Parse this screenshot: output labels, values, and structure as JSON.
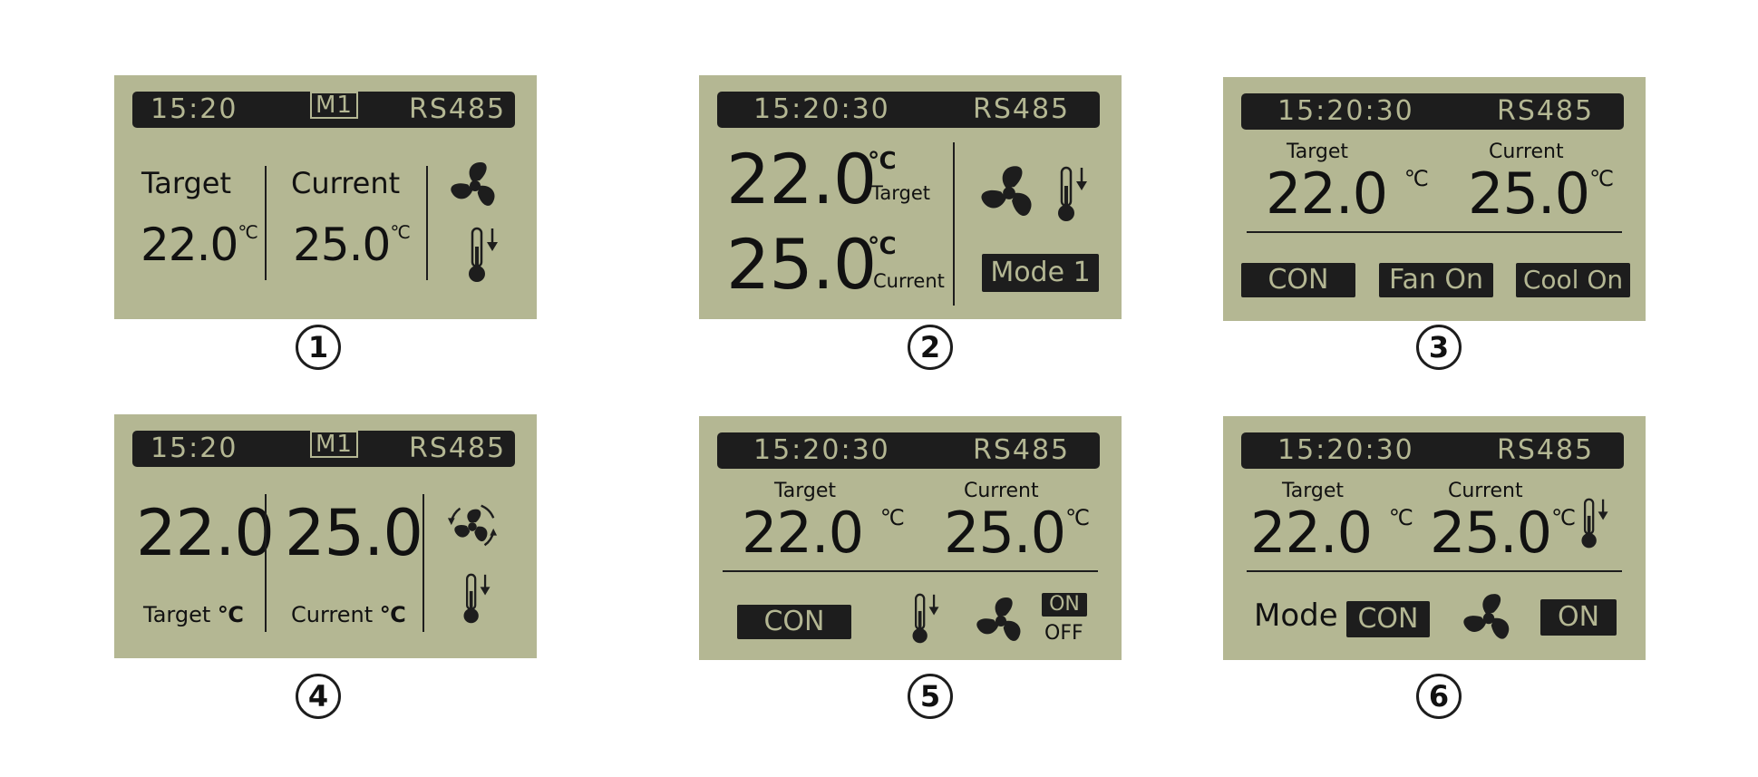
{
  "colors": {
    "lcd": "#b4b793",
    "ink": "#1d1d1d",
    "background": "#ffffff"
  },
  "icons": [
    "fan-icon",
    "fan-rotate-icon",
    "thermometer-down-icon"
  ],
  "screens": [
    {
      "index": "1",
      "clock": "15:20",
      "mode_badge": "M1",
      "comm": "RS485",
      "target_label": "Target",
      "target_value": "22.0",
      "current_label": "Current",
      "current_value": "25.0",
      "unit": "℃"
    },
    {
      "index": "2",
      "clock": "15:20:30",
      "comm": "RS485",
      "target_value": "22.0",
      "target_label": "Target",
      "current_value": "25.0",
      "current_label": "Current",
      "unit": "℃",
      "mode_label": "Mode 1"
    },
    {
      "index": "3",
      "clock": "15:20:30",
      "comm": "RS485",
      "target_label": "Target",
      "target_value": "22.0",
      "current_label": "Current",
      "current_value": "25.0",
      "unit": "℃",
      "chips": [
        "CON",
        "Fan On",
        "Cool On"
      ]
    },
    {
      "index": "4",
      "clock": "15:20",
      "mode_badge": "M1",
      "comm": "RS485",
      "target_value": "22.0",
      "current_value": "25.0",
      "target_label": "Target",
      "current_label": "Current",
      "unit": "℃"
    },
    {
      "index": "5",
      "clock": "15:20:30",
      "comm": "RS485",
      "target_label": "Target",
      "target_value": "22.0",
      "current_label": "Current",
      "current_value": "25.0",
      "unit": "℃",
      "mode_chip": "CON",
      "fan_on": "ON",
      "fan_off": "OFF"
    },
    {
      "index": "6",
      "clock": "15:20:30",
      "comm": "RS485",
      "target_label": "Target",
      "target_value": "22.0",
      "current_label": "Current",
      "current_value": "25.0",
      "unit": "℃",
      "mode_label": "Mode",
      "mode_chip": "CON",
      "fan_state": "ON"
    }
  ]
}
